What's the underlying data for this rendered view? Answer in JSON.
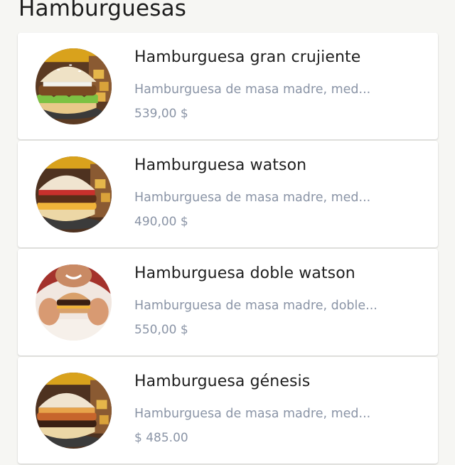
{
  "section": {
    "title": "Hamburguesas"
  },
  "products": [
    {
      "name": "Hamburguesa gran crujiente",
      "description": "Hamburguesa de masa madre, med...",
      "price": "539,00 $",
      "image": "burger-crispy-photo"
    },
    {
      "name": "Hamburguesa watson",
      "description": "Hamburguesa de masa madre, med...",
      "price": "490,00 $",
      "image": "burger-watson-photo"
    },
    {
      "name": "Hamburguesa doble watson",
      "description": "Hamburguesa de masa madre, doble...",
      "price": "550,00 $",
      "image": "burger-held-by-person-photo"
    },
    {
      "name": "Hamburguesa génesis",
      "description": "Hamburguesa de masa madre, med...",
      "price": "$ 485.00",
      "image": "burger-genesis-photo"
    }
  ],
  "colors": {
    "background": "#f6f6f3",
    "card": "#ffffff",
    "title_text": "#1f1f1f",
    "muted_text": "#8a94a6"
  }
}
